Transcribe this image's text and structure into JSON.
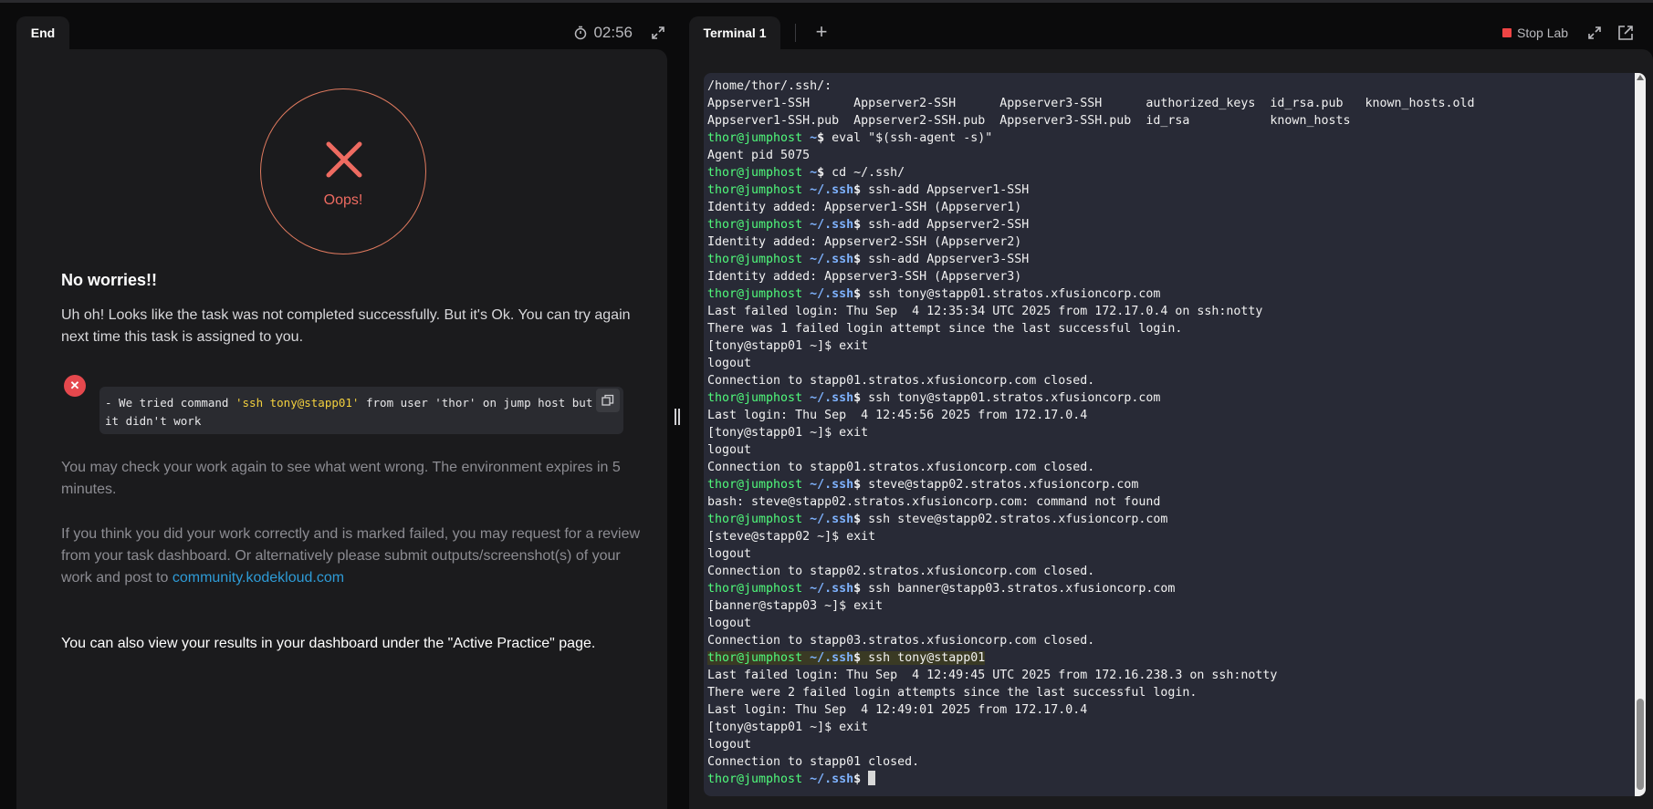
{
  "left": {
    "tab_label": "End",
    "timer": "02:56",
    "oops": "Oops!",
    "heading": "No worries!!",
    "para1": "Uh oh! Looks like the task was not completed successfully. But it's Ok. You can try again next time this task is assigned to you.",
    "error_prefix": " - We tried command ",
    "error_cmd": "'ssh tony@stapp01'",
    "error_mid": " from user 'thor' on jump host but",
    "error_line2": "it didn't work",
    "para2": "You may check your work again to see what went wrong. The environment expires in 5 minutes.",
    "para3_text": "If you think you did your work correctly and is marked failed, you may request for a review from your task dashboard. Or alternatively please submit outputs/screenshot(s) of your work and post to ",
    "para3_link": "community.kodekloud.com",
    "para4": "You can also view your results in your dashboard under the \"Active Practice\" page."
  },
  "right": {
    "tab_label": "Terminal 1",
    "add_tab": "+",
    "stop_lab": "Stop Lab"
  },
  "terminal": {
    "lines": [
      {
        "text": "/home/thor/.ssh/:"
      },
      {
        "text": "Appserver1-SSH      Appserver2-SSH      Appserver3-SSH      authorized_keys  id_rsa.pub   known_hosts.old"
      },
      {
        "text": "Appserver1-SSH.pub  Appserver2-SSH.pub  Appserver3-SSH.pub  id_rsa           known_hosts"
      },
      {
        "user": "thor@jumphost",
        "dir": "~",
        "cmd": " eval \"$(ssh-agent -s)\""
      },
      {
        "text": "Agent pid 5075"
      },
      {
        "user": "thor@jumphost",
        "dir": "~",
        "cmd": " cd ~/.ssh/"
      },
      {
        "user": "thor@jumphost",
        "dir": "~/.ssh",
        "cmd": " ssh-add Appserver1-SSH"
      },
      {
        "text": "Identity added: Appserver1-SSH (Appserver1)"
      },
      {
        "user": "thor@jumphost",
        "dir": "~/.ssh",
        "cmd": " ssh-add Appserver2-SSH"
      },
      {
        "text": "Identity added: Appserver2-SSH (Appserver2)"
      },
      {
        "user": "thor@jumphost",
        "dir": "~/.ssh",
        "cmd": " ssh-add Appserver3-SSH"
      },
      {
        "text": "Identity added: Appserver3-SSH (Appserver3)"
      },
      {
        "user": "thor@jumphost",
        "dir": "~/.ssh",
        "cmd": " ssh tony@stapp01.stratos.xfusioncorp.com"
      },
      {
        "text": "Last failed login: Thu Sep  4 12:35:34 UTC 2025 from 172.17.0.4 on ssh:notty"
      },
      {
        "text": "There was 1 failed login attempt since the last successful login."
      },
      {
        "text": "[tony@stapp01 ~]$ exit"
      },
      {
        "text": "logout"
      },
      {
        "text": "Connection to stapp01.stratos.xfusioncorp.com closed."
      },
      {
        "user": "thor@jumphost",
        "dir": "~/.ssh",
        "cmd": " ssh tony@stapp01.stratos.xfusioncorp.com"
      },
      {
        "text": "Last login: Thu Sep  4 12:45:56 2025 from 172.17.0.4"
      },
      {
        "text": "[tony@stapp01 ~]$ exit"
      },
      {
        "text": "logout"
      },
      {
        "text": "Connection to stapp01.stratos.xfusioncorp.com closed."
      },
      {
        "user": "thor@jumphost",
        "dir": "~/.ssh",
        "cmd": " steve@stapp02.stratos.xfusioncorp.com"
      },
      {
        "text": "bash: steve@stapp02.stratos.xfusioncorp.com: command not found"
      },
      {
        "user": "thor@jumphost",
        "dir": "~/.ssh",
        "cmd": " ssh steve@stapp02.stratos.xfusioncorp.com"
      },
      {
        "text": "[steve@stapp02 ~]$ exit"
      },
      {
        "text": "logout"
      },
      {
        "text": "Connection to stapp02.stratos.xfusioncorp.com closed."
      },
      {
        "user": "thor@jumphost",
        "dir": "~/.ssh",
        "cmd": " ssh banner@stapp03.stratos.xfusioncorp.com"
      },
      {
        "text": "[banner@stapp03 ~]$ exit"
      },
      {
        "text": "logout"
      },
      {
        "text": "Connection to stapp03.stratos.xfusioncorp.com closed."
      },
      {
        "user": "thor@jumphost",
        "dir": "~/.ssh",
        "cmd": " ssh tony@stapp01",
        "highlight": true
      },
      {
        "text": "Last failed login: Thu Sep  4 12:49:45 UTC 2025 from 172.16.238.3 on ssh:notty"
      },
      {
        "text": "There were 2 failed login attempts since the last successful login."
      },
      {
        "text": "Last login: Thu Sep  4 12:49:01 2025 from 172.17.0.4"
      },
      {
        "text": "[tony@stapp01 ~]$ exit"
      },
      {
        "text": "logout"
      },
      {
        "text": "Connection to stapp01 closed."
      },
      {
        "user": "thor@jumphost",
        "dir": "~/.ssh",
        "cmd": " ",
        "cursor": true
      }
    ]
  }
}
